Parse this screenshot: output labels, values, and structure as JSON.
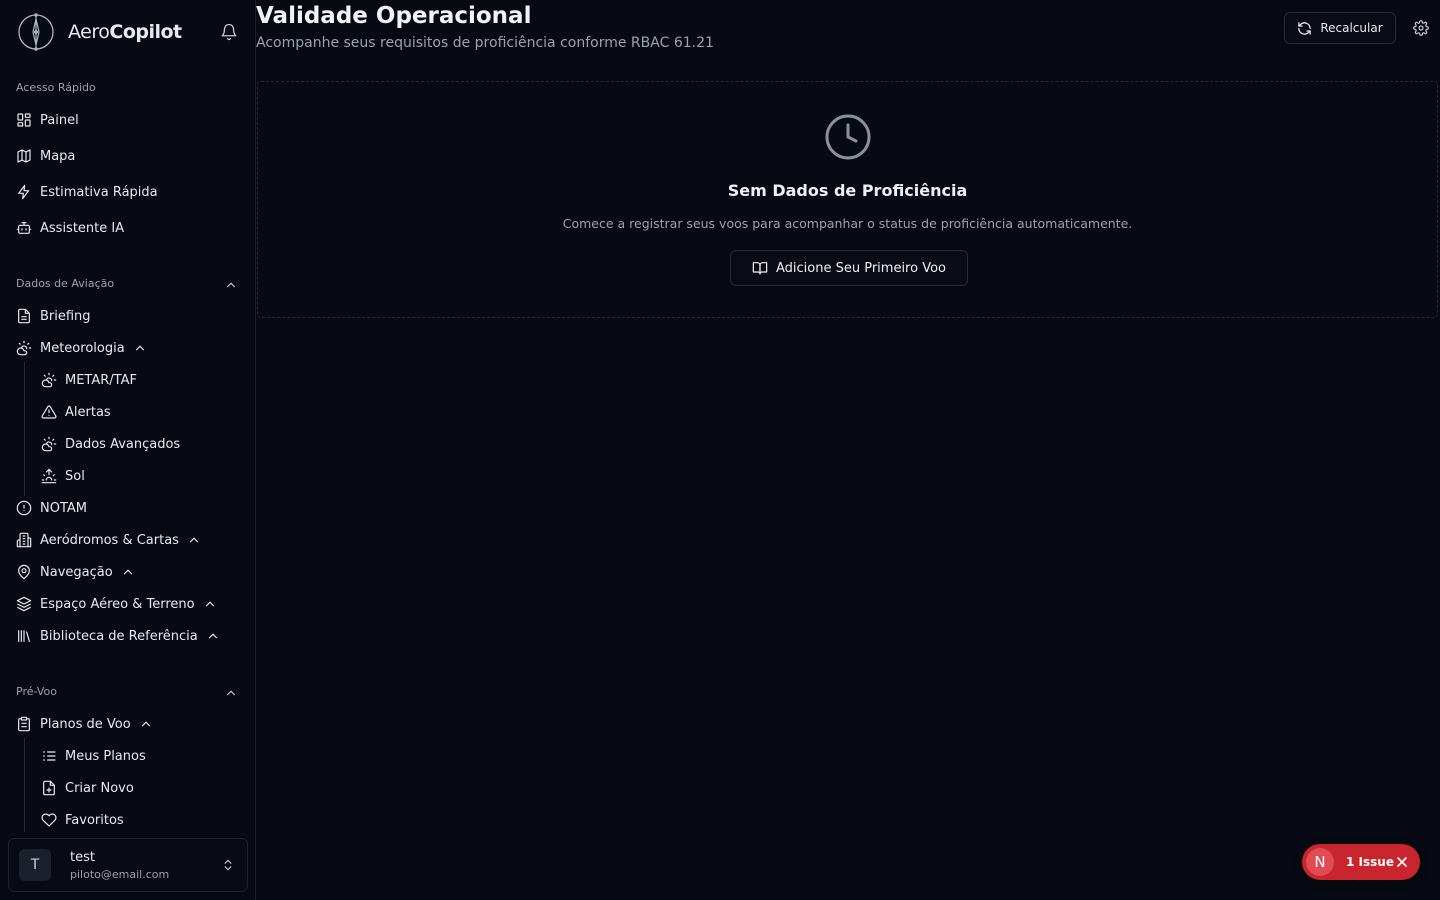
{
  "brand": {
    "name_light": "Aero",
    "name_bold": "Copilot"
  },
  "sidebar": {
    "quick_access": {
      "title": "Acesso Rápido",
      "items": [
        {
          "label": "Painel",
          "icon": "grid-icon"
        },
        {
          "label": "Mapa",
          "icon": "map-icon"
        },
        {
          "label": "Estimativa Rápida",
          "icon": "bolt-icon"
        },
        {
          "label": "Assistente IA",
          "icon": "bot-icon"
        }
      ]
    },
    "aviation_data": {
      "title": "Dados de Aviação",
      "items": [
        {
          "label": "Briefing",
          "icon": "file-icon"
        },
        {
          "label": "Meteorologia",
          "icon": "weather-icon"
        },
        {
          "label": "METAR/TAF",
          "icon": "weather-icon"
        },
        {
          "label": "Alertas",
          "icon": "warning-icon"
        },
        {
          "label": "Dados Avançados",
          "icon": "weather-icon"
        },
        {
          "label": "Sol",
          "icon": "sunrise-icon"
        },
        {
          "label": "NOTAM",
          "icon": "alert-circle-icon"
        },
        {
          "label": "Aeródromos & Cartas",
          "icon": "building-icon"
        },
        {
          "label": "Navegação",
          "icon": "pin-icon"
        },
        {
          "label": "Espaço Aéreo & Terreno",
          "icon": "layers-icon"
        },
        {
          "label": "Biblioteca de Referência",
          "icon": "library-icon"
        }
      ]
    },
    "preflight": {
      "title": "Pré-Voo",
      "items": [
        {
          "label": "Planos de Voo",
          "icon": "clipboard-icon"
        },
        {
          "label": "Meus Planos",
          "icon": "list-icon"
        },
        {
          "label": "Criar Novo",
          "icon": "file-plus-icon"
        },
        {
          "label": "Favoritos",
          "icon": "heart-icon"
        }
      ]
    },
    "user": {
      "initial": "T",
      "name": "test",
      "email": "piloto@email.com"
    }
  },
  "header": {
    "title": "Validade Operacional",
    "subtitle": "Acompanhe seus requisitos de proficiência conforme RBAC 61.21",
    "recalc_label": "Recalcular"
  },
  "empty_state": {
    "title": "Sem Dados de Proficiência",
    "description": "Comece a registrar seus voos para acompanhar o status de proficiência automaticamente.",
    "button_label": "Adicione Seu Primeiro Voo"
  },
  "issue_toast": {
    "badge": "N",
    "label": "1 Issue"
  },
  "colors": {
    "background": "#070a12",
    "issue_red": "#c9252f",
    "muted": "#9aa1ad"
  }
}
